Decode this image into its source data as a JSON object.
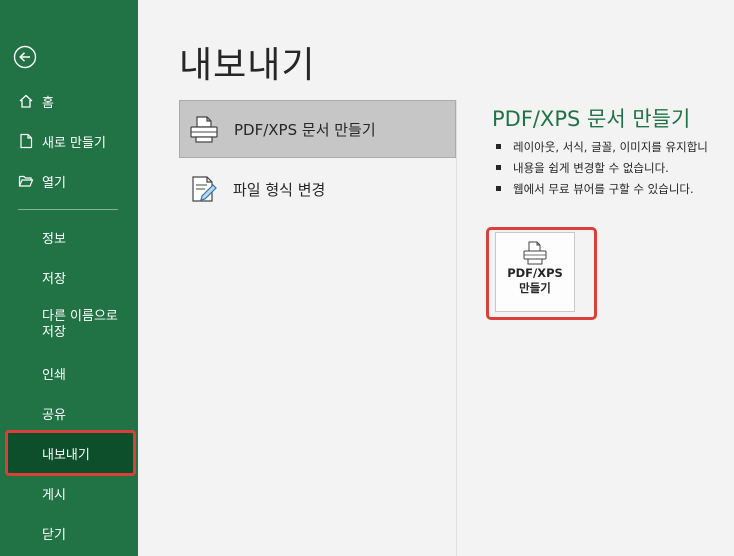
{
  "sidebar": {
    "back_icon": "arrow-left-circle-icon",
    "items": [
      {
        "label": "홈",
        "icon": "home-icon"
      },
      {
        "label": "새로 만들기",
        "icon": "new-document-icon"
      },
      {
        "label": "열기",
        "icon": "folder-open-icon"
      },
      {
        "label": "정보"
      },
      {
        "label": "저장"
      },
      {
        "label": "다른 이름으로 저장"
      },
      {
        "label": "인쇄"
      },
      {
        "label": "공유"
      },
      {
        "label": "내보내기"
      },
      {
        "label": "게시"
      },
      {
        "label": "닫기"
      }
    ],
    "multi_line_1": "다른 이름으로",
    "multi_line_2": "저장",
    "active": "내보내기",
    "colors": {
      "background": "#217346",
      "active": "#0c4f2a",
      "highlight": "#d9403a"
    }
  },
  "main": {
    "title": "내보내기",
    "options": [
      {
        "label": "PDF/XPS 문서 만들기",
        "icon": "printer-document-icon",
        "selected": true
      },
      {
        "label": "파일 형식 변경",
        "icon": "change-file-type-icon",
        "selected": false
      }
    ],
    "detail": {
      "title": "PDF/XPS 문서 만들기",
      "bullets": [
        "레이아웃, 서식, 글꼴, 이미지를 유지합니",
        "내용을 쉽게 변경할 수 없습니다.",
        "웹에서 무료 뷰어를 구할 수 있습니다."
      ],
      "button_line1": "PDF/XPS",
      "button_line2": "만들기",
      "button_icon": "printer-document-icon"
    }
  }
}
